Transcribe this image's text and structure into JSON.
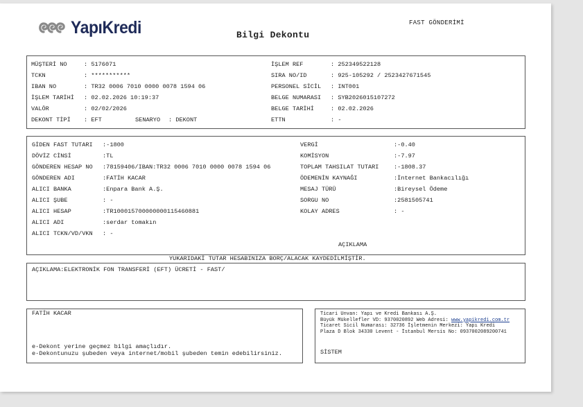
{
  "header": {
    "brand": "YapıKredi",
    "fast_label": "FAST GÖNDERİMİ",
    "title": "Bilgi Dekontu"
  },
  "info": {
    "musteri_no_label": "MÜŞTERİ NO",
    "musteri_no": ": 5176071",
    "tckn_label": "TCKN",
    "tckn": ": ***********",
    "iban_label": "IBAN NO",
    "iban": ": TR32 0006 7010 0000 0078 1594 06",
    "islem_tarihi_label": "İŞLEM TARİHİ",
    "islem_tarihi": ": 02.02.2026 10:19:37",
    "valor_label": "VALÖR",
    "valor": ": 02/02/2026",
    "dekont_tipi_label": "DEKONT TİPİ",
    "dekont_tipi": ": EFT",
    "senaryo_label": "SENARYO",
    "senaryo": ": DEKONT",
    "islem_ref_label": "İŞLEM REF",
    "islem_ref": ": 252349522128",
    "sira_no_label": "SIRA NO/ID",
    "sira_no": ": 925-105292 / 2523427671545",
    "personel_label": "PERSONEL SİCİL",
    "personel": ": INT001",
    "belge_no_label": "BELGE NUMARASI",
    "belge_no": ": SYB2026015107272",
    "belge_tarihi_label": "BELGE TARİHİ",
    "belge_tarihi": ": 02.02.2026",
    "ettn_label": "ETTN",
    "ettn": ": -"
  },
  "transfer": {
    "giden_label": "GİDEN FAST TUTARI",
    "giden": ":-1800",
    "doviz_label": "DÖVİZ CİNSİ",
    "doviz": ":TL",
    "gonderen_hesap_label": "GÖNDEREN HESAP NO",
    "gonderen_hesap": ":78159406/IBAN:TR32 0006 7010 0000 0078 1594 06",
    "gonderen_adi_label": "GÖNDEREN ADI",
    "gonderen_adi": ":FATİH KACAR",
    "alici_banka_label": "ALICI BANKA",
    "alici_banka": ":Enpara Bank A.Ş.",
    "alici_sube_label": "ALICI ŞUBE",
    "alici_sube": ": -",
    "alici_hesap_label": "ALICI HESAP",
    "alici_hesap": ":TR100015700000000115460881",
    "alici_adi_label": "ALICI ADI",
    "alici_adi": ":serdar tomakın",
    "alici_tckn_label": "ALICI TCKN/VD/VKN",
    "alici_tckn": ": -",
    "vergi_label": "VERGİ",
    "vergi": ":-0.40",
    "komisyon_label": "KOMİSYON",
    "komisyon": ":-7.97",
    "toplam_label": "TOPLAM TAHSILAT TUTARI",
    "toplam": ":-1808.37",
    "odeme_kaynak_label": "ÖDEMENİN KAYNAĞI",
    "odeme_kaynak": ":İnternet Bankacılığı",
    "mesaj_turu_label": "MESAJ TÜRÜ",
    "mesaj_turu": ":Bireysel Ödeme",
    "sorgu_no_label": "SORGU NO",
    "sorgu_no": ":2581505741",
    "kolay_adres_label": "KOLAY ADRES",
    "kolay_adres": ": -",
    "aciklama_heading": "AÇIKLAMA"
  },
  "notice": "YUKARIDAKİ TUTAR HESABINIZA BORÇ/ALACAK KAYDEDİLMİŞTİR.",
  "description": "AÇIKLAMA:ELEKTRONİK FON TRANSFERİ (EFT) ÜCRETİ - FAST/",
  "footer_left": {
    "name": "FATİH KACAR",
    "note1": "e-Dekont yerine geçmez bilgi amaçlıdır.",
    "note2": "e-Dekontunuzu şubeden veya internet/mobil şubeden temin edebilirsiniz."
  },
  "footer_right": {
    "line1": "Ticari Unvan: Yapı ve Kredi Bankası A.Ş.",
    "line2_pre": "Büyük Mükellefler VD: 9370020892 Web Adresi: ",
    "line2_link": "www.yapikredi.com.tr",
    "line3": "Ticaret Sicil Numarası: 32736 İşletmenin Merkezi: Yapı Kredi",
    "line4": "Plaza D Blok 34330 Levent - İstanbul Mersis No: 0937002089200741",
    "sistem": "SİSTEM"
  },
  "colors": {
    "brand_navy": "#1e2a58",
    "brand_grey": "#8a8a8a",
    "link": "#1a3d8f"
  }
}
